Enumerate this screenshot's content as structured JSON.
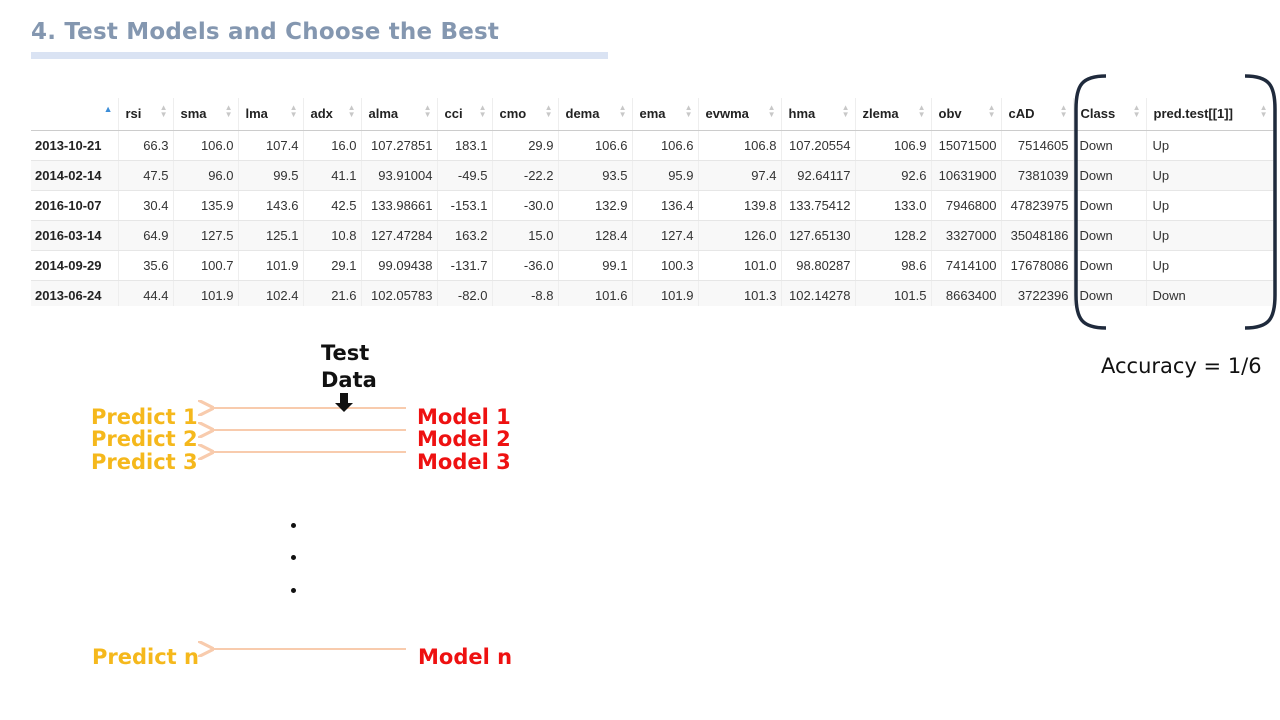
{
  "title": "4. Test Models and Choose the Best",
  "table": {
    "corner": "",
    "columns": [
      "rsi",
      "sma",
      "lma",
      "adx",
      "alma",
      "cci",
      "cmo",
      "dema",
      "ema",
      "evwma",
      "hma",
      "zlema",
      "obv",
      "cAD",
      "Class",
      "pred.test[[1]]"
    ],
    "rows": [
      [
        "2013-10-21",
        "66.3",
        "106.0",
        "107.4",
        "16.0",
        "107.27851",
        "183.1",
        "29.9",
        "106.6",
        "106.6",
        "106.8",
        "107.20554",
        "106.9",
        "15071500",
        "7514605",
        "Down",
        "Up"
      ],
      [
        "2014-02-14",
        "47.5",
        "96.0",
        "99.5",
        "41.1",
        "93.91004",
        "-49.5",
        "-22.2",
        "93.5",
        "95.9",
        "97.4",
        "92.64117",
        "92.6",
        "10631900",
        "7381039",
        "Down",
        "Up"
      ],
      [
        "2016-10-07",
        "30.4",
        "135.9",
        "143.6",
        "42.5",
        "133.98661",
        "-153.1",
        "-30.0",
        "132.9",
        "136.4",
        "139.8",
        "133.75412",
        "133.0",
        "7946800",
        "47823975",
        "Down",
        "Up"
      ],
      [
        "2016-03-14",
        "64.9",
        "127.5",
        "125.1",
        "10.8",
        "127.47284",
        "163.2",
        "15.0",
        "128.4",
        "127.4",
        "126.0",
        "127.65130",
        "128.2",
        "3327000",
        "35048186",
        "Down",
        "Up"
      ],
      [
        "2014-09-29",
        "35.6",
        "100.7",
        "101.9",
        "29.1",
        "99.09438",
        "-131.7",
        "-36.0",
        "99.1",
        "100.3",
        "101.0",
        "98.80287",
        "98.6",
        "7414100",
        "17678086",
        "Down",
        "Up"
      ],
      [
        "2013-06-24",
        "44.4",
        "101.9",
        "102.4",
        "21.6",
        "102.05783",
        "-82.0",
        "-8.8",
        "101.6",
        "101.9",
        "101.3",
        "102.14278",
        "101.5",
        "8663400",
        "3722396",
        "Down",
        "Down"
      ]
    ]
  },
  "accuracy": "Accuracy  = 1/6",
  "diagram": {
    "test_data_line1": "Test",
    "test_data_line2": "Data",
    "predicts": [
      "Predict 1",
      "Predict 2",
      "Predict 3"
    ],
    "models": [
      "Model 1",
      "Model 2",
      "Model 3"
    ],
    "predict_n": "Predict n",
    "model_n": "Model n"
  },
  "colors": {
    "title": "#8497b0",
    "predict": "#f5b81c",
    "model": "#ee1111",
    "arrow": "#f8cbad",
    "sort_active": "#3c8dd8"
  }
}
